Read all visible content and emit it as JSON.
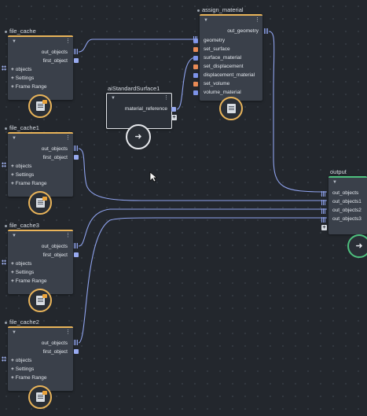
{
  "canvas": {
    "background": "#23272d"
  },
  "colors": {
    "header_orange": "#e9b45a",
    "header_green": "#4ec07e",
    "port_blue": "#7d93e8",
    "port_orange": "#e88a55",
    "wire": "#8fa3ee"
  },
  "nodes": {
    "file_cache": {
      "title": "file_cache",
      "out1": "out_objects",
      "out2": "first_object",
      "objects": "objects",
      "settings": "Settings",
      "frame_range": "Frame Range",
      "icon": "file-cache-icon"
    },
    "file_cache1": {
      "title": "file_cache1",
      "out1": "out_objects",
      "out2": "first_object",
      "objects": "objects",
      "settings": "Settings",
      "frame_range": "Frame Range",
      "icon": "file-cache-icon"
    },
    "file_cache3": {
      "title": "file_cache3",
      "out1": "out_objects",
      "out2": "first_object",
      "objects": "objects",
      "settings": "Settings",
      "frame_range": "Frame Range",
      "icon": "file-cache-icon"
    },
    "file_cache2": {
      "title": "file_cache2",
      "out1": "out_objects",
      "out2": "first_object",
      "objects": "objects",
      "settings": "Settings",
      "frame_range": "Frame Range",
      "icon": "file-cache-icon"
    },
    "assign_material": {
      "title": "assign_material",
      "out": "out_geometry",
      "inputs": [
        "geometry",
        "set_surface",
        "surface_material",
        "set_displacement",
        "displacement_material",
        "set_volume",
        "volume_material"
      ],
      "input_colors": [
        "blue",
        "orange",
        "blue",
        "orange",
        "blue",
        "orange",
        "blue"
      ],
      "icon": "material-icon"
    },
    "aiStandardSurface1": {
      "title": "aiStandardSurface1",
      "out": "material_reference",
      "icon": "arrow-right-icon"
    },
    "output": {
      "title": "output",
      "inputs": [
        "out_objects",
        "out_objects1",
        "out_objects2",
        "out_objects3"
      ],
      "icon": "arrow-right-icon"
    }
  }
}
